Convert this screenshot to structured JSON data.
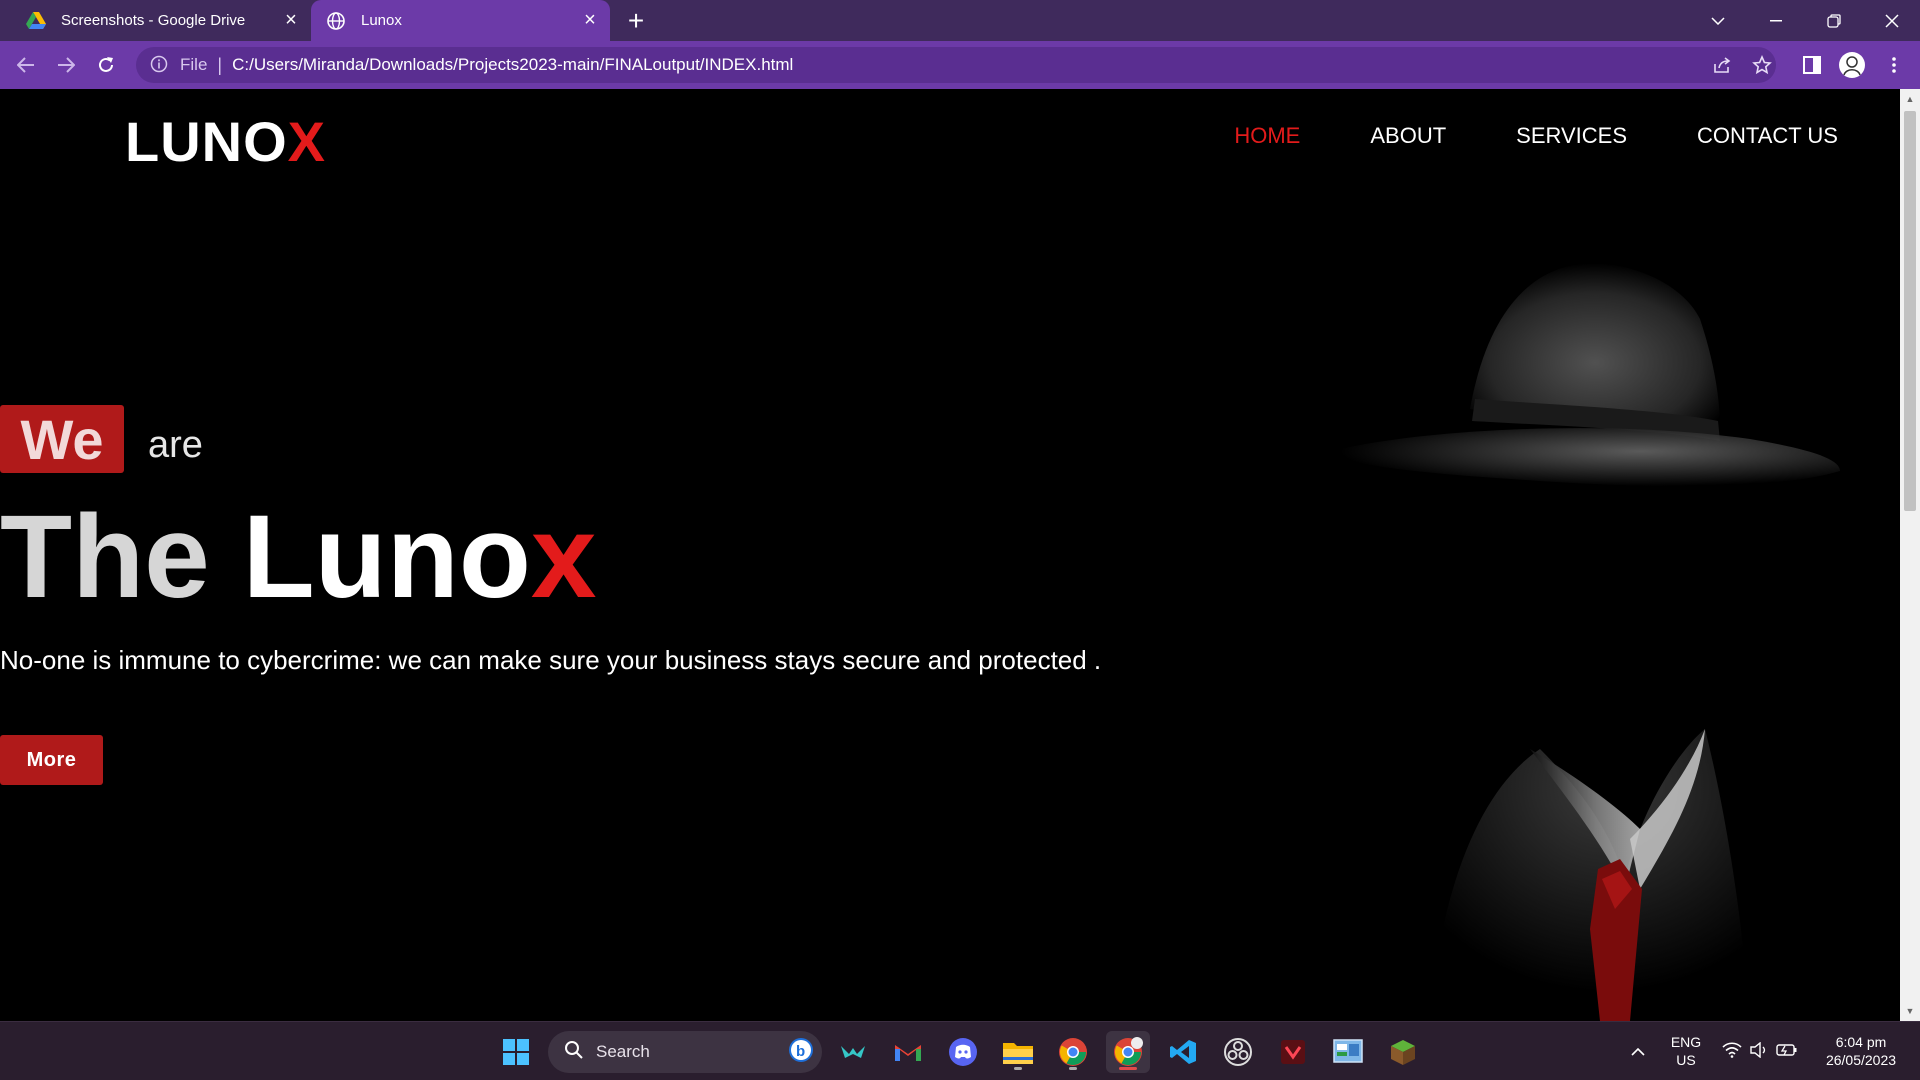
{
  "browser": {
    "tabs": [
      {
        "title": "Screenshots - Google Drive",
        "icon": "google-drive-icon",
        "active": false
      },
      {
        "title": "Lunox",
        "icon": "globe-icon",
        "active": true
      }
    ],
    "address": {
      "scheme_label": "File",
      "url": "C:/Users/Miranda/Downloads/Projects2023-main/FINALoutput/INDEX.html"
    },
    "colors": {
      "frame": "#3f2a5c",
      "toolbar": "#6c3aa8"
    }
  },
  "site": {
    "logo": {
      "main": "LUNO",
      "accent": "X"
    },
    "nav": [
      {
        "label": "HOME",
        "active": true
      },
      {
        "label": "ABOUT",
        "active": false
      },
      {
        "label": "SERVICES",
        "active": false
      },
      {
        "label": "CONTACT US",
        "active": false
      }
    ],
    "hero": {
      "we": "We",
      "are": "are",
      "headline_the": "The",
      "headline_main": "Luno",
      "headline_accent": "x",
      "tagline": "No-one is immune to cybercrime: we can make sure your business stays secure and protected .",
      "button": "More"
    },
    "colors": {
      "accent": "#e31b1b",
      "button": "#b01a1a",
      "background": "#000000"
    }
  },
  "taskbar": {
    "search_label": "Search",
    "apps": [
      "start-icon",
      "bing-icon",
      "bird-app-icon",
      "gmail-icon",
      "discord-icon",
      "file-explorer-icon",
      "chrome-icon",
      "chrome-profile-icon",
      "vscode-icon",
      "obs-icon",
      "red-app-icon",
      "control-panel-icon",
      "minecraft-icon"
    ],
    "lang": {
      "line1": "ENG",
      "line2": "US"
    },
    "time": "6:04 pm",
    "date": "26/05/2023"
  }
}
